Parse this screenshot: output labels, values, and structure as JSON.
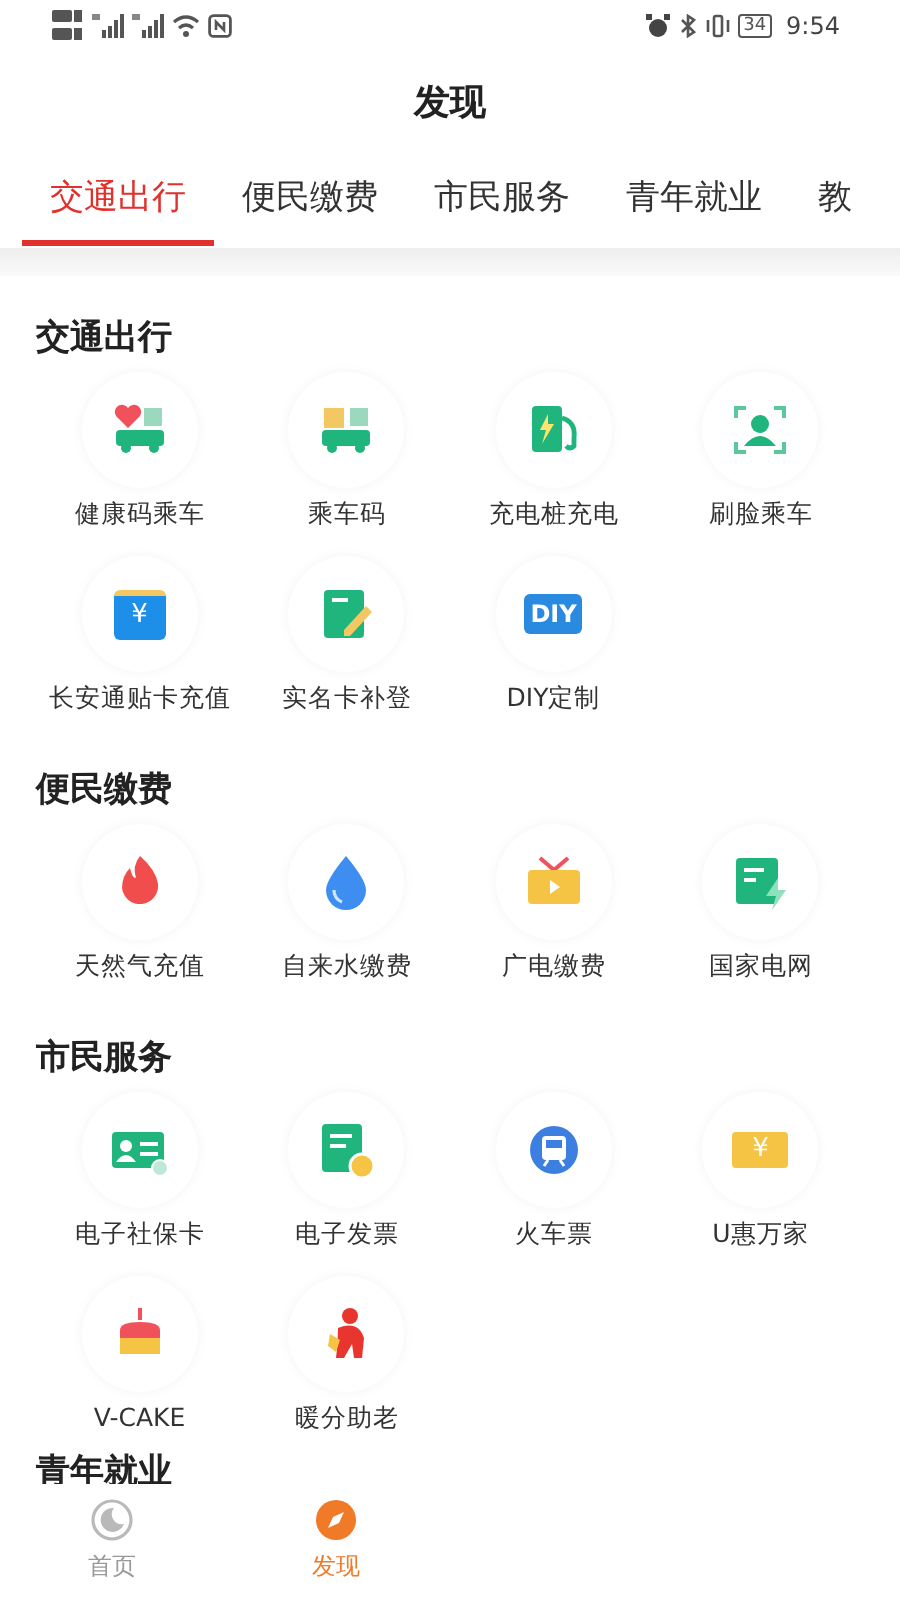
{
  "status_bar": {
    "battery": "34",
    "time": "9:54"
  },
  "title": "发现",
  "tabs": [
    {
      "label": "交通出行",
      "selected": true
    },
    {
      "label": "便民缴费",
      "selected": false
    },
    {
      "label": "市民服务",
      "selected": false
    },
    {
      "label": "青年就业",
      "selected": false
    },
    {
      "label": "教",
      "selected": false
    }
  ],
  "sections": [
    {
      "title": "交通出行",
      "items": [
        {
          "label": "健康码乘车"
        },
        {
          "label": "乘车码"
        },
        {
          "label": "充电桩充电"
        },
        {
          "label": "刷脸乘车"
        },
        {
          "label": "长安通贴卡充值",
          "icon_text": "¥"
        },
        {
          "label": "实名卡补登"
        },
        {
          "label": "DIY定制",
          "icon_text": "DIY"
        }
      ]
    },
    {
      "title": "便民缴费",
      "items": [
        {
          "label": "天然气充值"
        },
        {
          "label": "自来水缴费"
        },
        {
          "label": "广电缴费"
        },
        {
          "label": "国家电网"
        }
      ]
    },
    {
      "title": "市民服务",
      "items": [
        {
          "label": "电子社保卡"
        },
        {
          "label": "电子发票"
        },
        {
          "label": "火车票"
        },
        {
          "label": "U惠万家",
          "icon_text": "¥"
        },
        {
          "label": "V-CAKE"
        },
        {
          "label": "暖分助老"
        }
      ]
    },
    {
      "title": "青年就业"
    }
  ],
  "bottom_nav": [
    {
      "label": "首页",
      "selected": false
    },
    {
      "label": "发现",
      "selected": true
    }
  ]
}
